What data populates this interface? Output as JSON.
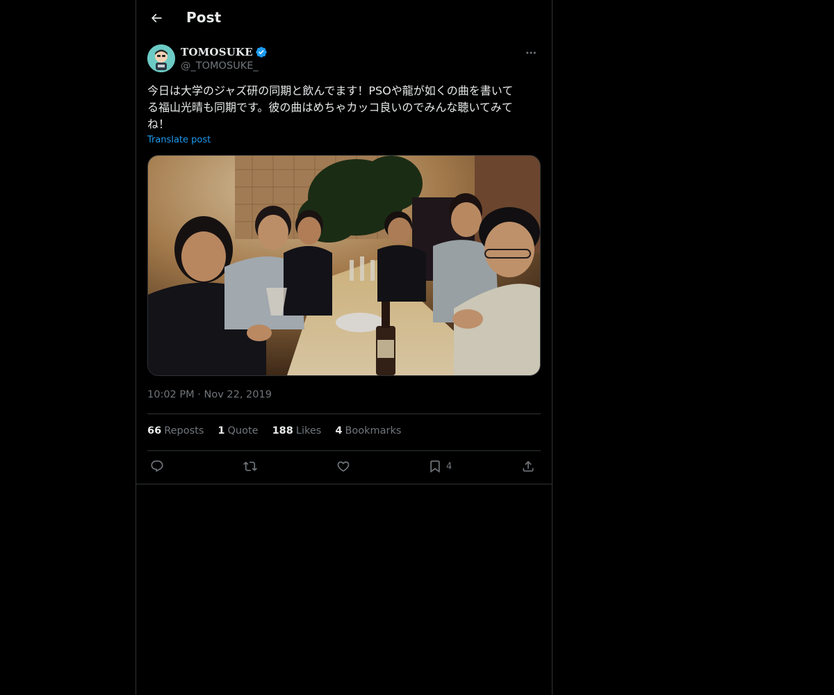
{
  "header": {
    "title": "Post"
  },
  "author": {
    "display_name": "TOMOSUKE",
    "handle": "@_TOMOSUKE_",
    "verified": true
  },
  "post": {
    "text": "今日は大学のジャズ研の同期と飲んでます！PSOや龍が如くの曲を書いて\nる福山光晴も同期です。彼の曲はめちゃカッコ良いのでみんな聴いてみて\nね！",
    "translate_label": "Translate post",
    "timestamp": "10:02 PM · Nov 22, 2019"
  },
  "stats": {
    "reposts": {
      "count": "66",
      "label": "Reposts"
    },
    "quotes": {
      "count": "1",
      "label": "Quote"
    },
    "likes": {
      "count": "188",
      "label": "Likes"
    },
    "bookmarks": {
      "count": "4",
      "label": "Bookmarks"
    }
  },
  "actions": {
    "reply_icon": "reply-icon",
    "repost_icon": "repost-icon",
    "like_icon": "heart-icon",
    "bookmark_icon": "bookmark-icon",
    "bookmark_count": "4",
    "share_icon": "share-icon"
  },
  "colors": {
    "background": "#000000",
    "text": "#e7e9ea",
    "muted": "#71767b",
    "accent": "#1d9bf0",
    "border": "#2f3336"
  }
}
